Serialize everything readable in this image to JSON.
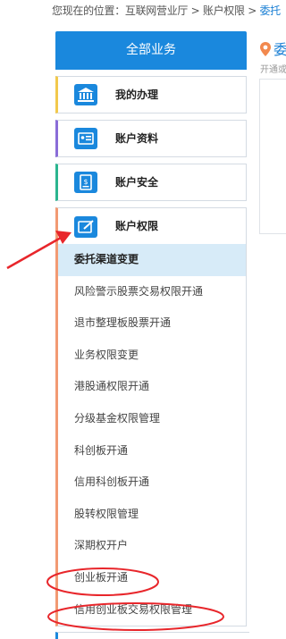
{
  "breadcrumb": {
    "prefix": "您现在的位置：互联网营业厅 > 账户权限 > ",
    "current": "委托"
  },
  "sidebar": {
    "header": "全部业务",
    "items": [
      {
        "label": "我的办理",
        "accent": "#f2c94c"
      },
      {
        "label": "账户资料",
        "accent": "#8a6dd8"
      },
      {
        "label": "账户安全",
        "accent": "#2bb58f"
      }
    ],
    "open_group": {
      "label": "账户权限",
      "accent": "#f29a73",
      "subitems": [
        "委托渠道变更",
        "风险警示股票交易权限开通",
        "退市整理板股票开通",
        "业务权限变更",
        "港股通权限开通",
        "分级基金权限管理",
        "科创板开通",
        "信用科创板开通",
        "股转权限管理",
        "深期权开户",
        "创业板开通",
        "信用创业板交易权限管理"
      ]
    }
  },
  "right_panel": {
    "title": "委",
    "subtitle": "开通或"
  },
  "colors": {
    "primary": "#1a88dd",
    "active_bg": "#d7ebf8",
    "annotation_red": "#e8262b"
  }
}
